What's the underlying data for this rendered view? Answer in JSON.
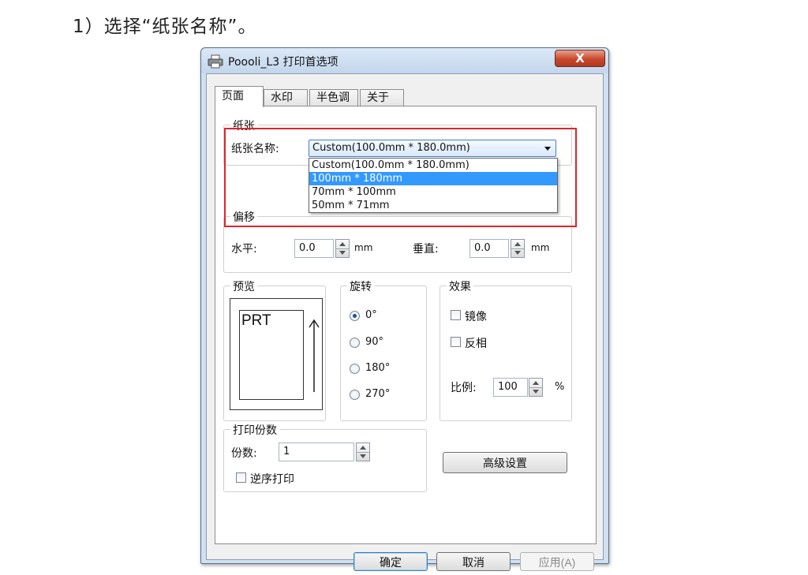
{
  "instruction": "1）选择“纸张名称”。",
  "window": {
    "title": "Poooli_L3 打印首选项",
    "close_label": "X"
  },
  "tabs": [
    {
      "label": "页面",
      "active": true
    },
    {
      "label": "水印",
      "active": false
    },
    {
      "label": "半色调",
      "active": false
    },
    {
      "label": "关于",
      "active": false
    }
  ],
  "paper": {
    "group_label": "纸张",
    "name_label": "纸张名称:",
    "selected_value": "Custom(100.0mm * 180.0mm)",
    "options": [
      "Custom(100.0mm * 180.0mm)",
      "100mm * 180mm",
      "70mm * 100mm",
      "50mm * 71mm"
    ],
    "highlighted_index": 1
  },
  "offset": {
    "group_label": "偏移",
    "horizontal_label": "水平:",
    "horizontal_value": "0.0",
    "horizontal_unit": "mm",
    "vertical_label": "垂直:",
    "vertical_value": "0.0",
    "vertical_unit": "mm"
  },
  "preview": {
    "group_label": "预览",
    "sample_text": "PRT"
  },
  "rotation": {
    "group_label": "旋转",
    "options": [
      "0°",
      "90°",
      "180°",
      "270°"
    ],
    "selected_index": 0
  },
  "effects": {
    "group_label": "效果",
    "mirror_label": "镜像",
    "invert_label": "反相",
    "scale_label": "比例:",
    "scale_value": "100",
    "scale_unit": "%"
  },
  "copies": {
    "group_label": "打印份数",
    "count_label": "份数:",
    "count_value": "1",
    "reverse_label": "逆序打印"
  },
  "buttons": {
    "advanced": "高级设置",
    "ok": "确定",
    "cancel": "取消",
    "apply": "应用(A)"
  },
  "colors": {
    "highlight": "#3399ff",
    "annotation_red": "#e0242a",
    "titlebar": "#c3d6ec"
  }
}
